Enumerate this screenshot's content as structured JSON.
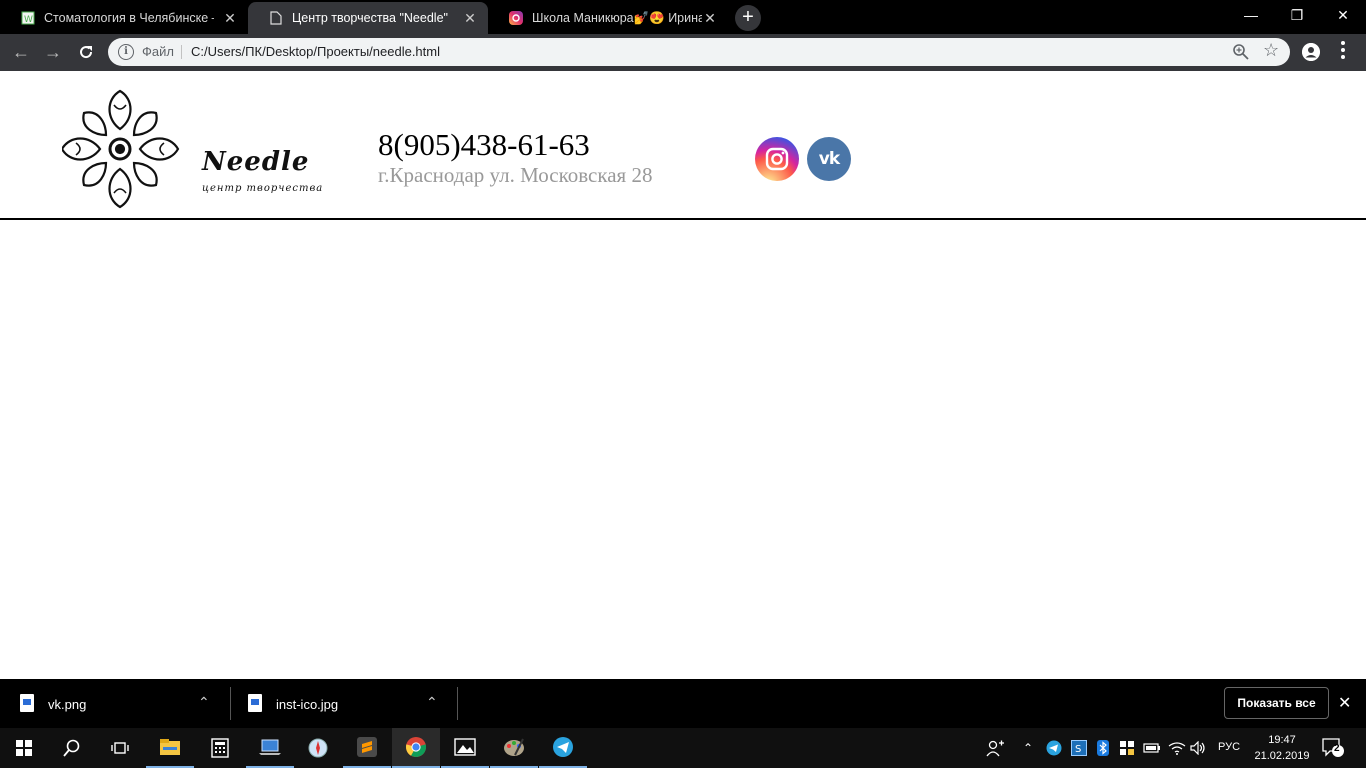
{
  "browser": {
    "tabs": [
      {
        "title": "Стоматология в Челябинске —",
        "favicon": "green-doc-icon",
        "active": false
      },
      {
        "title": "Центр творчества \"Needle\"",
        "favicon": "page-icon",
        "active": true
      },
      {
        "title": "Школа Маникюра💅😍 Ирина",
        "favicon": "instagram-icon",
        "active": false
      }
    ],
    "new_tab_label": "+",
    "address": {
      "scheme_label": "Файл",
      "url": "C:/Users/ПК/Desktop/Проекты/needle.html"
    }
  },
  "site": {
    "brand_name": "Needle",
    "brand_sub": "центр творчества",
    "phone": "8(905)438-61-63",
    "address": "г.Краснодар ул. Московская 28",
    "social": [
      {
        "name": "instagram",
        "icon": "instagram-icon"
      },
      {
        "name": "vk",
        "icon": "vk-icon",
        "glyph": "vk"
      }
    ]
  },
  "downloads": {
    "items": [
      {
        "filename": "vk.png"
      },
      {
        "filename": "inst-ico.jpg"
      }
    ],
    "show_all_label": "Показать все"
  },
  "taskbar": {
    "language": "РУС",
    "time": "19:47",
    "date": "21.02.2019",
    "notification_count": "2"
  }
}
